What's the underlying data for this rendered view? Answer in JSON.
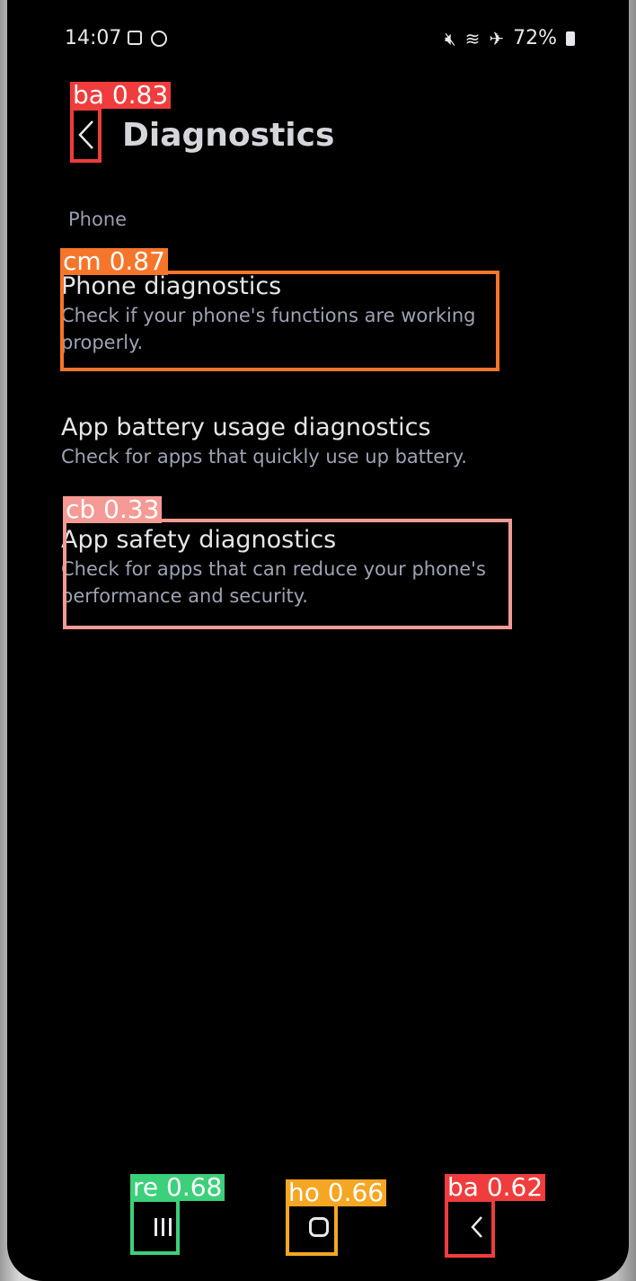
{
  "status_bar": {
    "time": "14:07",
    "battery": "72%",
    "icons": [
      "checkbox-icon",
      "circle-icon",
      "mute-icon",
      "wifi-icon",
      "airplane-icon",
      "battery-icon"
    ]
  },
  "header": {
    "back_icon": "chevron-left-icon",
    "title": "Diagnostics"
  },
  "sections": [
    {
      "label": "Phone",
      "items": [
        {
          "title": "Phone diagnostics",
          "subtitle_1": "Check if your phone's functions are working",
          "subtitle_2": "properly."
        },
        {
          "title": "App battery usage diagnostics",
          "subtitle_1": "Check for apps that quickly use up battery.",
          "subtitle_2": ""
        },
        {
          "title": "App safety diagnostics",
          "subtitle_1": "Check for apps that can reduce your phone's",
          "subtitle_2": "performance and security."
        }
      ]
    }
  ],
  "detections": [
    {
      "label": "ba 0.83",
      "color": "#f03c3c"
    },
    {
      "label": "cm 0.87",
      "color": "#f5752a"
    },
    {
      "label": "cb 0.33",
      "color": "#f59a94"
    },
    {
      "label": "re 0.68",
      "color": "#3cd07a"
    },
    {
      "label": "ho 0.66",
      "color": "#f5a623"
    },
    {
      "label": "ba 0.62",
      "color": "#f03c3c"
    }
  ],
  "nav_bar": {
    "recents_icon": "recents-icon",
    "home_icon": "home-icon",
    "back_icon": "back-icon"
  }
}
